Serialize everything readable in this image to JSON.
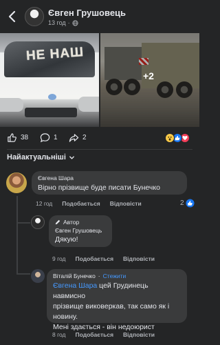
{
  "header": {
    "author_name": "Євген Грушовець",
    "time": "13 год",
    "separator": "·"
  },
  "photos": {
    "van_text": "НЕ НАШ",
    "more_count": "+2"
  },
  "reactions": {
    "likes": "38",
    "comments": "1",
    "shares": "2"
  },
  "sort_label": "Найактуальніші",
  "comments": [
    {
      "author": "Євгена Шара",
      "text": "Вірно прізвище  буде писати Бунечко",
      "time": "12 год",
      "like_label": "Подобається",
      "reply_label": "Відповісти",
      "like_count": "2"
    },
    {
      "badge": "Автор",
      "author": "Євген Грушовець",
      "text": "Дякую!",
      "time": "9 год",
      "like_label": "Подобається",
      "reply_label": "Відповісти"
    },
    {
      "author": "Віталій Бунечко",
      "follow_label": "Стежити",
      "mention": "Євгена Шара",
      "text_rest_1": " цей Грудинець навмисно",
      "text_rest_2": "прізвище виковеркав, так само як і",
      "text_rest_3": "новину.",
      "text_rest_4": "Мені здається - він недоюрист",
      "time": "8 год",
      "like_label": "Подобається",
      "reply_label": "Відповісти"
    }
  ],
  "colors": {
    "background": "#242526",
    "bubble": "#3a3b3c",
    "link": "#4599ff"
  }
}
